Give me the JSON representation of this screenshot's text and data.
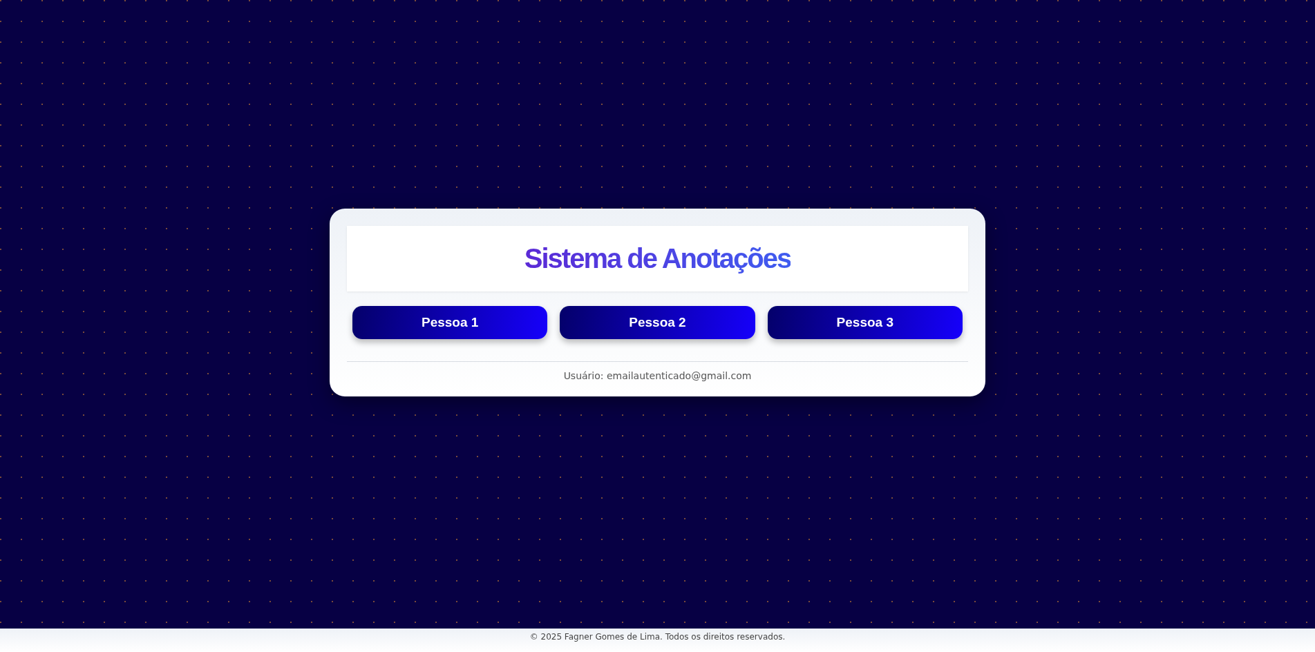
{
  "header": {
    "title": "Sistema de Anotações"
  },
  "buttons": [
    {
      "label": "Pessoa 1"
    },
    {
      "label": "Pessoa 2"
    },
    {
      "label": "Pessoa 3"
    }
  ],
  "user": {
    "text": "Usuário: emailautenticado@gmail.com"
  },
  "footer": {
    "text": "© 2025 Fagner Gomes de Lima. Todos os direitos reservados."
  }
}
